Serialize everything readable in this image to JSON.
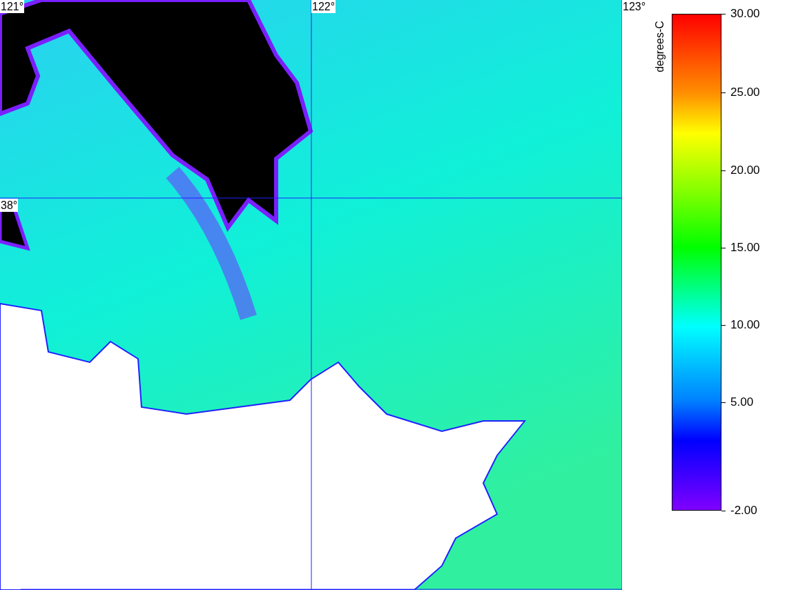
{
  "map": {
    "lon_labels": [
      "121°",
      "122°",
      "123°"
    ],
    "lat_labels": [
      "38°"
    ]
  },
  "colorbar": {
    "unit": "degrees-C",
    "ticks": [
      "30.00",
      "25.00",
      "20.00",
      "15.00",
      "10.00",
      "5.00",
      "-2.00"
    ]
  }
}
